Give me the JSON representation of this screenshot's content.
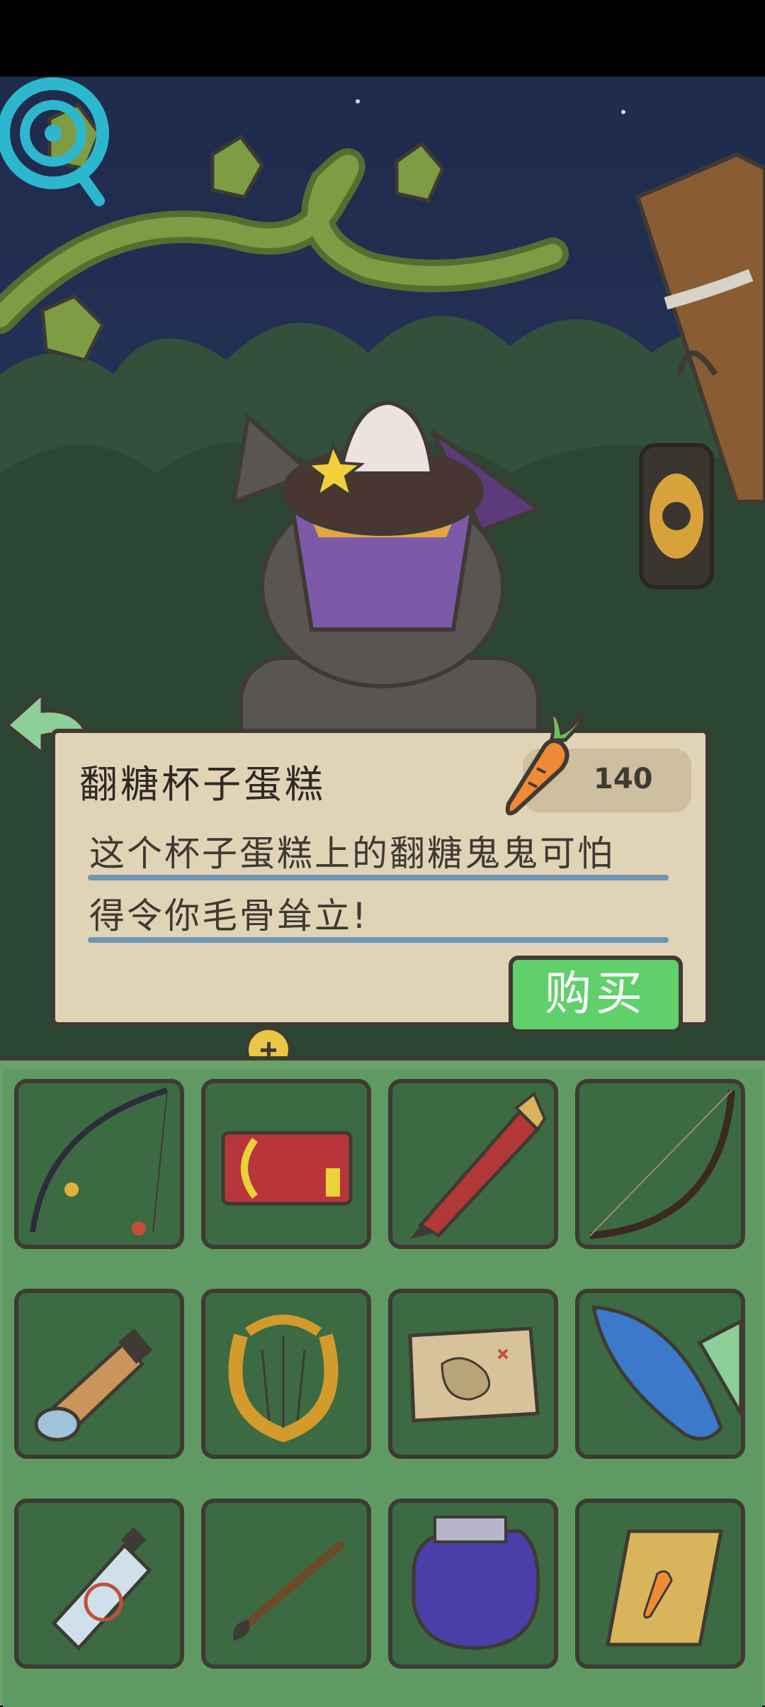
{
  "item": {
    "name": "翻糖杯子蛋糕",
    "price": "140",
    "description_line1": "这个杯子蛋糕上的翻糖鬼鬼可怕",
    "description_line2": "得令你毛骨耸立!",
    "buy_label": "购买",
    "currency_icon": "carrot-icon"
  },
  "inventory": {
    "items": [
      {
        "name": "fishing-rod-icon"
      },
      {
        "name": "ticket-card-icon"
      },
      {
        "name": "pen-icon"
      },
      {
        "name": "bow-icon"
      },
      {
        "name": "telescope-icon"
      },
      {
        "name": "lyre-icon"
      },
      {
        "name": "treasure-map-icon"
      },
      {
        "name": "surfboard-icon"
      },
      {
        "name": "spray-can-icon"
      },
      {
        "name": "paintbrush-icon"
      },
      {
        "name": "boxing-glove-icon"
      },
      {
        "name": "carrot-book-icon"
      }
    ]
  },
  "colors": {
    "panel_bg": "#e1d3b6",
    "buy_button": "#5fd06a",
    "inventory_bg": "#5f9a62",
    "slot_bg": "#3c6a42",
    "outline": "#3f3a33"
  }
}
